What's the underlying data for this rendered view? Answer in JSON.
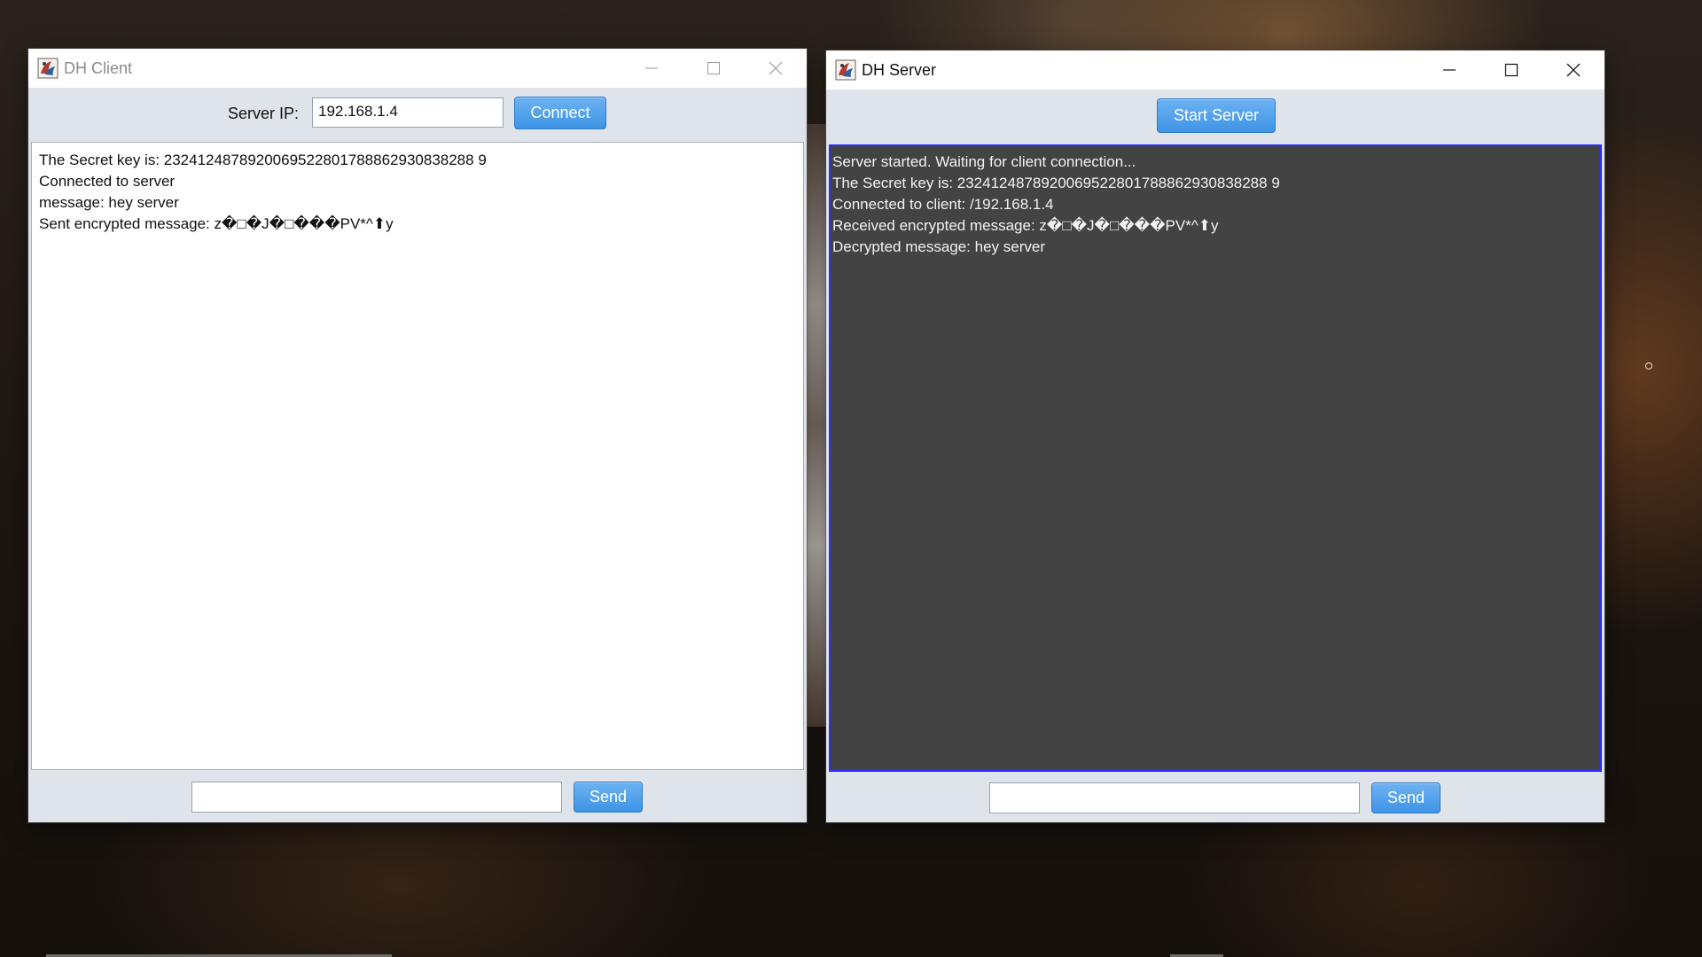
{
  "client": {
    "title": "DH Client",
    "server_ip_label": "Server IP:",
    "server_ip_value": "192.168.1.4",
    "connect_label": "Connect",
    "log_lines": [
      "The Secret key is: 2324124878920069522801788862930838288 9",
      "Connected to server",
      "message: hey server",
      "Sent encrypted message: z�□�J�□���PV*^⬆y"
    ],
    "message_value": "",
    "send_label": "Send"
  },
  "server": {
    "title": "DH Server",
    "start_label": "Start Server",
    "log_lines": [
      "Server started. Waiting for client connection...",
      "The Secret key is: 2324124878920069522801788862930838288 9",
      "Connected to client: /192.168.1.4",
      "Received encrypted message: z�□�J�□���PV*^⬆y",
      "Decrypted message: hey server"
    ],
    "message_value": "",
    "send_label": "Send"
  },
  "icons": {
    "app": "java-app-icon",
    "minimize": "minimize-icon",
    "maximize": "maximize-icon",
    "close": "close-icon"
  },
  "colors": {
    "button_blue": "#3e94e6",
    "server_log_bg": "#434343",
    "server_log_focus_border": "#2d2dff"
  }
}
